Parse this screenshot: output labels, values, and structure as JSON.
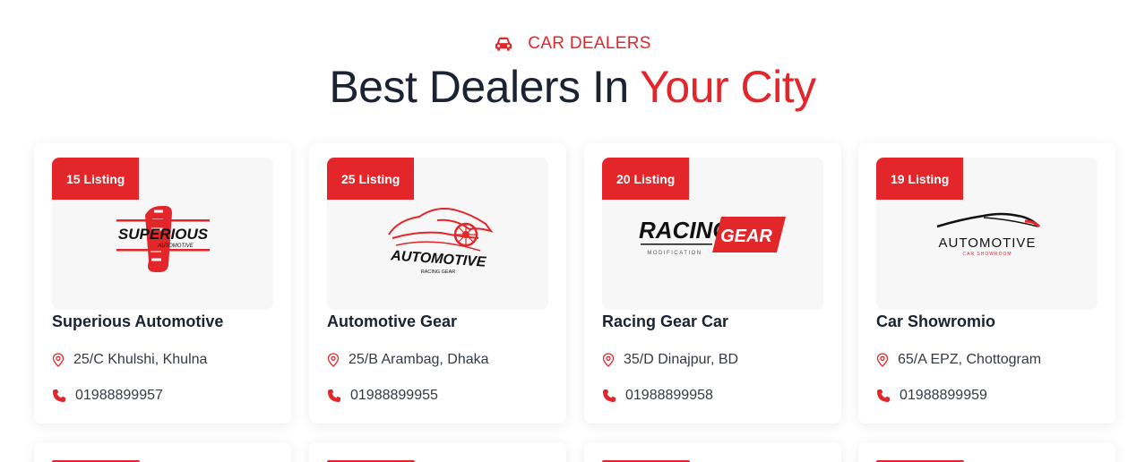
{
  "header": {
    "eyebrow_icon": "car-icon",
    "eyebrow_text": "CAR DEALERS",
    "title_main": "Best Dealers In ",
    "title_accent": "Your City"
  },
  "colors": {
    "accent": "#e2262a",
    "heading": "#1b2333",
    "text": "#333a45",
    "thumb_bg": "#f7f7f7"
  },
  "dealers": [
    {
      "listing": "15 Listing",
      "logo_text": "SUPERIOUS",
      "logo_sub": "AUTOMOTIVE",
      "name": "Superious Automotive",
      "address": "25/C Khulshi, Khulna",
      "phone": "01988899957"
    },
    {
      "listing": "25 Listing",
      "logo_text": "AUTOMOTIVE",
      "logo_sub": "RACING GEAR",
      "name": "Automotive Gear",
      "address": "25/B Arambag, Dhaka",
      "phone": "01988899955"
    },
    {
      "listing": "20 Listing",
      "logo_text": "RACING",
      "logo_text2": "GEAR",
      "logo_sub": "MODIFICATION",
      "name": "Racing Gear Car",
      "address": "35/D Dinajpur, BD",
      "phone": "01988899958"
    },
    {
      "listing": "19 Listing",
      "logo_text": "AUTOMOTIVE",
      "logo_sub": "CAR SHOWROOM",
      "name": "Car Showromio",
      "address": "65/A EPZ, Chottogram",
      "phone": "01988899959"
    }
  ],
  "icons": {
    "address": "map-pin-icon",
    "phone": "phone-icon"
  }
}
